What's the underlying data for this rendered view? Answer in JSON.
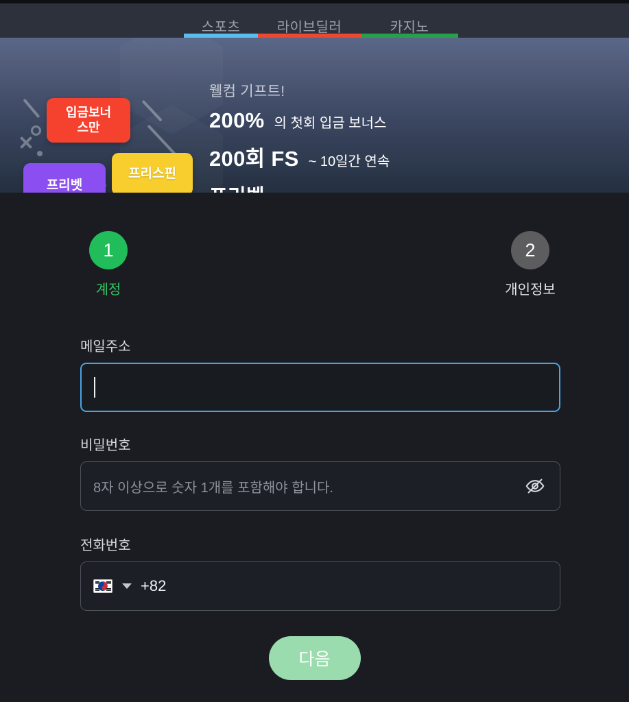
{
  "tabbar": {
    "tabs": [
      {
        "label": "스포츠",
        "color": "#5bbdef"
      },
      {
        "label": "라이브딜러",
        "color": "#f0472f"
      },
      {
        "label": "카지노",
        "color": "#27a04a"
      }
    ]
  },
  "banner": {
    "chips": [
      {
        "name": "deposit-bonus",
        "label": "입금보너\n스만",
        "color": "#f5422f"
      },
      {
        "name": "free-bet",
        "label": "프리벳",
        "color": "#8b4ef0"
      },
      {
        "name": "free-spin",
        "label": "프리스핀",
        "color": "#f7ce2e"
      }
    ],
    "chips_text": {
      "deposit": "입금보너\n스만",
      "freebet": "프리벳",
      "freespin": "프리스핀"
    },
    "welcome": "웰컴 기프트!",
    "line1_big": "200%",
    "line1_small": "의 첫회 입금 보너스",
    "line2_big": "200회 FS",
    "line2_small": "~ 10일간 연속",
    "line3": "프리벳"
  },
  "stepper": {
    "step1": {
      "number": "1",
      "label": "계정",
      "state": "active",
      "color": "#22bd5b"
    },
    "step2": {
      "number": "2",
      "label": "개인정보",
      "state": "idle",
      "color": "#5d5d5f"
    }
  },
  "form": {
    "email": {
      "label": "메일주소",
      "value": "",
      "placeholder": "",
      "focused": true,
      "focus_color": "#4aa4e3"
    },
    "password": {
      "label": "비밀번호",
      "value": "",
      "placeholder": "8자 이상으로 숫자 1개를 포함해야 합니다.",
      "toggle_icon": "eye-off-icon"
    },
    "phone": {
      "label": "전화번호",
      "country_flag": "south-korea-flag-icon",
      "dial_code": "+82",
      "value": "",
      "dropdown_icon": "chevron-down-icon"
    }
  },
  "submit": {
    "label": "다음",
    "color": "#9adcae"
  }
}
